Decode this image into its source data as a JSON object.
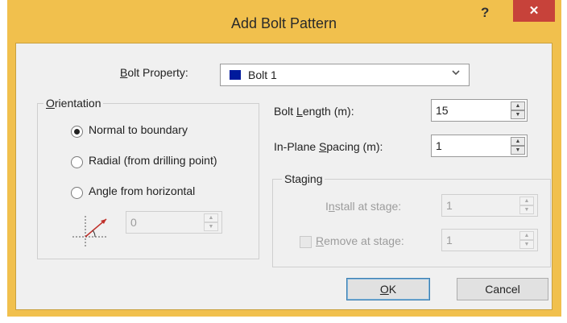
{
  "window": {
    "title": "Add Bolt Pattern",
    "help_label": "?",
    "close_label": "✕"
  },
  "colors": {
    "titlebar": "#f1c04d",
    "close_button": "#c7423a",
    "bolt_swatch": "#001a9c",
    "dialog_bg": "#f0f0f0"
  },
  "bolt_property": {
    "label_u": "B",
    "label_rest": "olt Property:",
    "selected": "Bolt 1",
    "swatch_color": "#001a9c",
    "dropdown_icon": "chevron-down-icon"
  },
  "orientation": {
    "legend_u": "O",
    "legend_rest": "rientation",
    "options": [
      {
        "label": "Normal to boundary",
        "selected": true
      },
      {
        "label": "Radial (from drilling point)",
        "selected": false
      },
      {
        "label": "Angle from horizontal",
        "selected": false
      }
    ],
    "angle_icon": "angle-icon",
    "angle_value": "0"
  },
  "bolt_length": {
    "label_pre": "Bolt ",
    "label_u": "L",
    "label_post": "ength (m):",
    "value": "15"
  },
  "spacing": {
    "label_pre": "In-Plane ",
    "label_u": "S",
    "label_post": "pacing (m):",
    "value": "1"
  },
  "staging": {
    "legend": "Staging",
    "install": {
      "label_pre": "I",
      "label_u": "n",
      "label_post": "stall at stage:",
      "value": "1"
    },
    "remove": {
      "label_u": "R",
      "label_post": "emove at stage:",
      "value": "1",
      "checked": false
    }
  },
  "buttons": {
    "ok_u": "O",
    "ok_rest": "K",
    "cancel": "Cancel"
  }
}
